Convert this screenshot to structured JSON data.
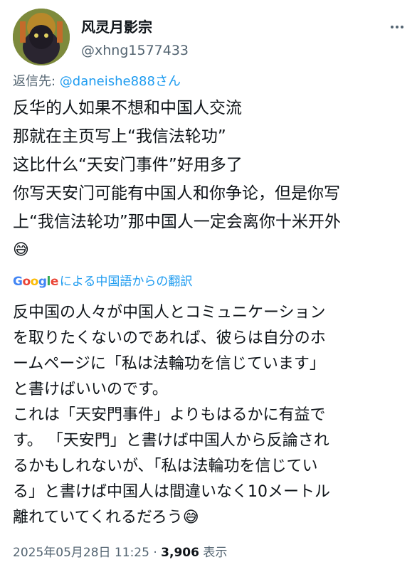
{
  "author": {
    "name": "风灵月影宗",
    "handle": "@xhng1577433"
  },
  "reply": {
    "prefix": "返信先: ",
    "mention": "@daneishe888さん"
  },
  "tweet_lines": [
    "反华的人如果不想和中国人交流",
    "那就在主页写上“我信法轮功”",
    "这比什么“天安门事件”好用多了",
    "你写天安门可能有中国人和你争论，但是你写",
    "上“我信法轮功”那中国人一定会离你十米开外",
    "😅"
  ],
  "translation": {
    "google_letters": [
      "G",
      "o",
      "o",
      "g",
      "l",
      "e"
    ],
    "label": "による中国語からの翻訳",
    "lines": [
      "反中国の人々が中国人とコミュニケーション",
      "を取りたくないのであれば、彼らは自分のホ",
      "ームページに「私は法輪功を信じています」",
      "と書けばいいのです。",
      "これは「天安門事件」よりもはるかに有益で",
      "す。 「天安門」と書けば中国人から反論され",
      "るかもしれないが、「私は法輪功を信じてい",
      "る」と書けば中国人は間違いなく10メートル",
      "離れていてくれるだろう😅"
    ]
  },
  "meta": {
    "timestamp": "2025年05月28日 11:25",
    "separator": " · ",
    "views": "3,906",
    "views_label": " 表示"
  },
  "icons": {
    "more": "more-options-icon"
  }
}
